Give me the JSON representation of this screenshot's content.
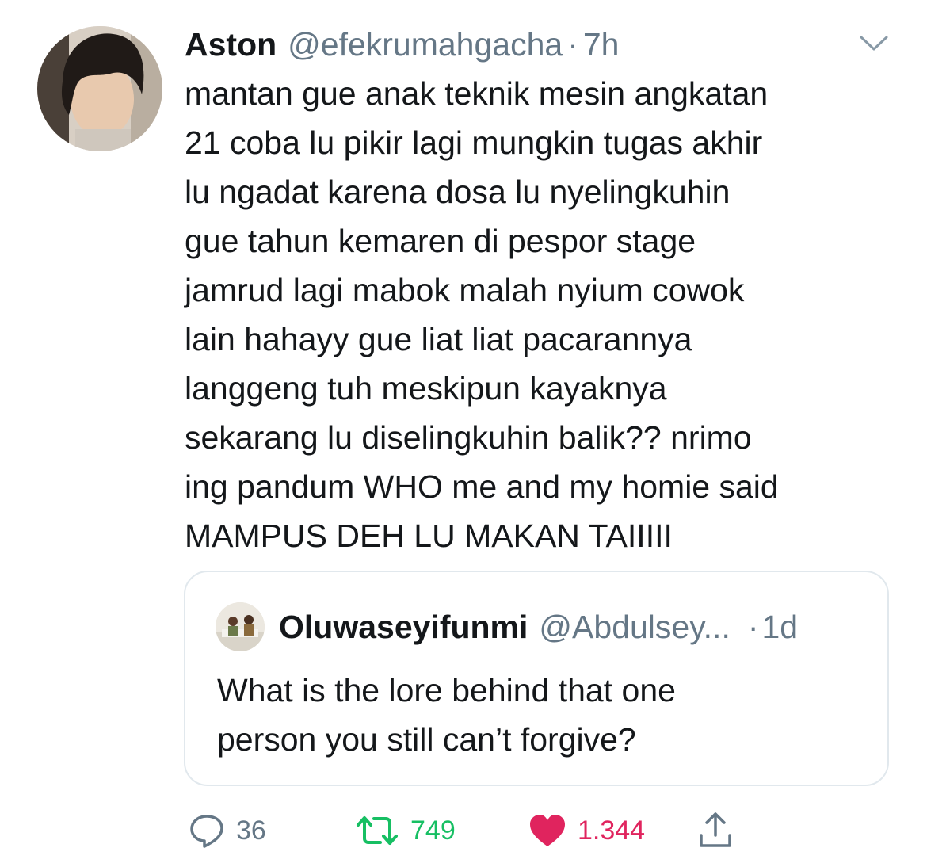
{
  "tweet": {
    "author_name": "Aston",
    "author_handle": "@efekrumahgacha",
    "separator": "·",
    "time": "7h",
    "text": "mantan gue anak teknik mesin angkatan\n21 coba lu pikir lagi mungkin tugas akhir\nlu ngadat karena dosa lu nyelingkuhin\ngue tahun kemaren di pespor stage\njamrud lagi mabok malah nyium cowok\nlain hahayy gue liat liat pacarannya\nlanggeng tuh meskipun kayaknya\nsekarang lu diselingkuhin balik?? nrimo\ning pandum WHO me and my homie said\nMAMPUS DEH LU MAKAN TAIIIII"
  },
  "quoted_tweet": {
    "author_name": "Oluwaseyifunmi",
    "author_handle": "@Abdulsey...",
    "separator": "·",
    "time": "1d",
    "text": "What is the lore behind that one\nperson you still can’t forgive?"
  },
  "actions": {
    "reply_count": "36",
    "retweet_count": "749",
    "like_count": "1.344"
  },
  "colors": {
    "text": "#14171a",
    "secondary": "#657786",
    "retweet": "#17bf63",
    "like": "#e0245e",
    "border": "#e1e8ed"
  },
  "icons": [
    "chevron-down-icon",
    "reply-icon",
    "retweet-icon",
    "like-icon",
    "share-icon"
  ]
}
